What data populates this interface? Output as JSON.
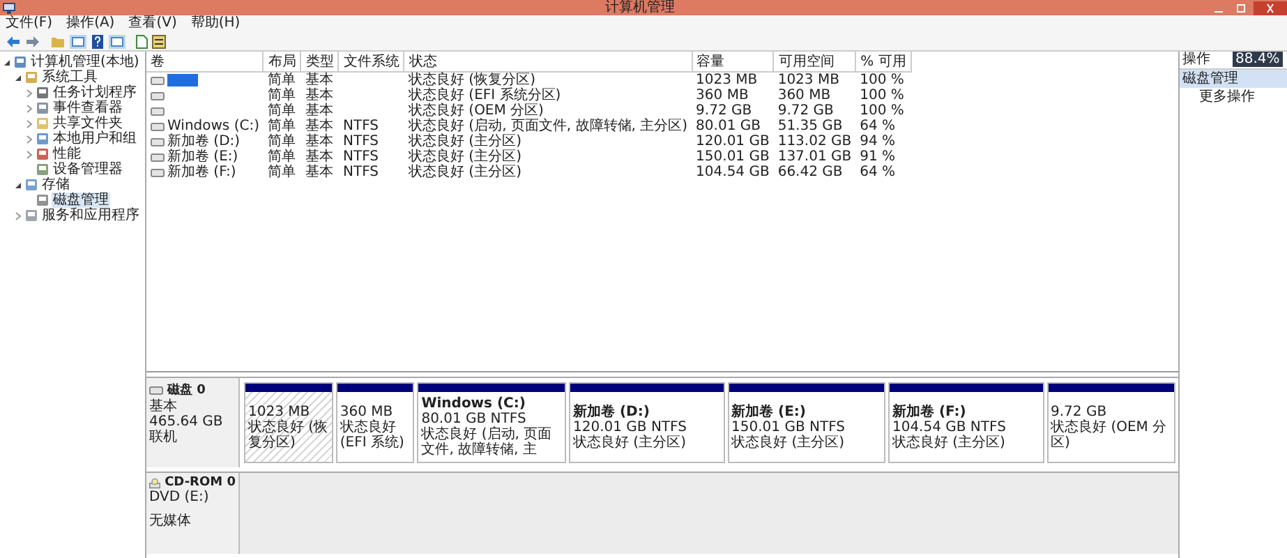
{
  "window": {
    "title": "计算机管理"
  },
  "menu": [
    "文件(F)",
    "操作(A)",
    "查看(V)",
    "帮助(H)"
  ],
  "tree": [
    {
      "label": "计算机管理(本地)",
      "expanded": true,
      "selected": false,
      "children": [
        {
          "label": "系统工具",
          "expanded": true,
          "selected": false,
          "children": [
            {
              "label": "任务计划程序",
              "expanded": false,
              "selected": false
            },
            {
              "label": "事件查看器",
              "expanded": false,
              "selected": false
            },
            {
              "label": "共享文件夹",
              "expanded": false,
              "selected": false
            },
            {
              "label": "本地用户和组",
              "expanded": false,
              "selected": false
            },
            {
              "label": "性能",
              "expanded": false,
              "selected": false
            },
            {
              "label": "设备管理器",
              "selected": false
            }
          ]
        },
        {
          "label": "存储",
          "expanded": true,
          "selected": false,
          "children": [
            {
              "label": "磁盘管理",
              "selected": true
            }
          ]
        },
        {
          "label": "服务和应用程序",
          "expanded": false,
          "selected": false
        }
      ]
    }
  ],
  "table": {
    "columns": [
      "卷",
      "布局",
      "类型",
      "文件系统",
      "状态",
      "容量",
      "可用空间",
      "% 可用"
    ],
    "rows": [
      {
        "redacted": true,
        "cells": [
          "",
          "简单",
          "基本",
          "",
          "状态良好 (恢复分区)",
          "1023 MB",
          "1023 MB",
          "100 %"
        ]
      },
      {
        "cells": [
          "",
          "简单",
          "基本",
          "",
          "状态良好 (EFI 系统分区)",
          "360 MB",
          "360 MB",
          "100 %"
        ]
      },
      {
        "cells": [
          "",
          "简单",
          "基本",
          "",
          "状态良好 (OEM 分区)",
          "9.72 GB",
          "9.72 GB",
          "100 %"
        ]
      },
      {
        "cells": [
          "Windows (C:)",
          "简单",
          "基本",
          "NTFS",
          "状态良好 (启动, 页面文件, 故障转储, 主分区)",
          "80.01 GB",
          "51.35 GB",
          "64 %"
        ]
      },
      {
        "cells": [
          "新加卷 (D:)",
          "简单",
          "基本",
          "NTFS",
          "状态良好 (主分区)",
          "120.01 GB",
          "113.02 GB",
          "94 %"
        ]
      },
      {
        "cells": [
          "新加卷 (E:)",
          "简单",
          "基本",
          "NTFS",
          "状态良好 (主分区)",
          "150.01 GB",
          "137.01 GB",
          "91 %"
        ]
      },
      {
        "cells": [
          "新加卷 (F:)",
          "简单",
          "基本",
          "NTFS",
          "状态良好 (主分区)",
          "104.54 GB",
          "66.42 GB",
          "64 %"
        ]
      }
    ]
  },
  "disks": [
    {
      "kind": "disk",
      "name": "磁盘 0",
      "lines": [
        "基本",
        "465.64 GB",
        "联机"
      ],
      "partitions": [
        {
          "kind": "recovery",
          "size": "1023 MB",
          "status": "状态良好 (恢复分区)"
        },
        {
          "kind": "primary",
          "size": "360 MB",
          "status": "状态良好 (EFI 系统)"
        },
        {
          "kind": "primary",
          "title": "Windows  (C:)",
          "size": "80.01 GB NTFS",
          "status": "状态良好 (启动, 页面文件, 故障转储, 主"
        },
        {
          "kind": "primary",
          "title": "新加卷  (D:)",
          "size": "120.01 GB NTFS",
          "status": "状态良好 (主分区)"
        },
        {
          "kind": "primary",
          "title": "新加卷  (E:)",
          "size": "150.01 GB NTFS",
          "status": "状态良好 (主分区)"
        },
        {
          "kind": "primary",
          "title": "新加卷  (F:)",
          "size": "104.54 GB NTFS",
          "status": "状态良好 (主分区)"
        },
        {
          "kind": "primary",
          "size": "9.72 GB",
          "status": "状态良好 (OEM 分区)"
        }
      ]
    },
    {
      "kind": "cdrom",
      "name": "CD-ROM 0",
      "lines": [
        "DVD (E:)",
        "无媒体"
      ]
    }
  ],
  "actions": {
    "title": "操作",
    "section": "磁盘管理",
    "items": [
      "更多操作"
    ]
  },
  "badge": "88.4%"
}
